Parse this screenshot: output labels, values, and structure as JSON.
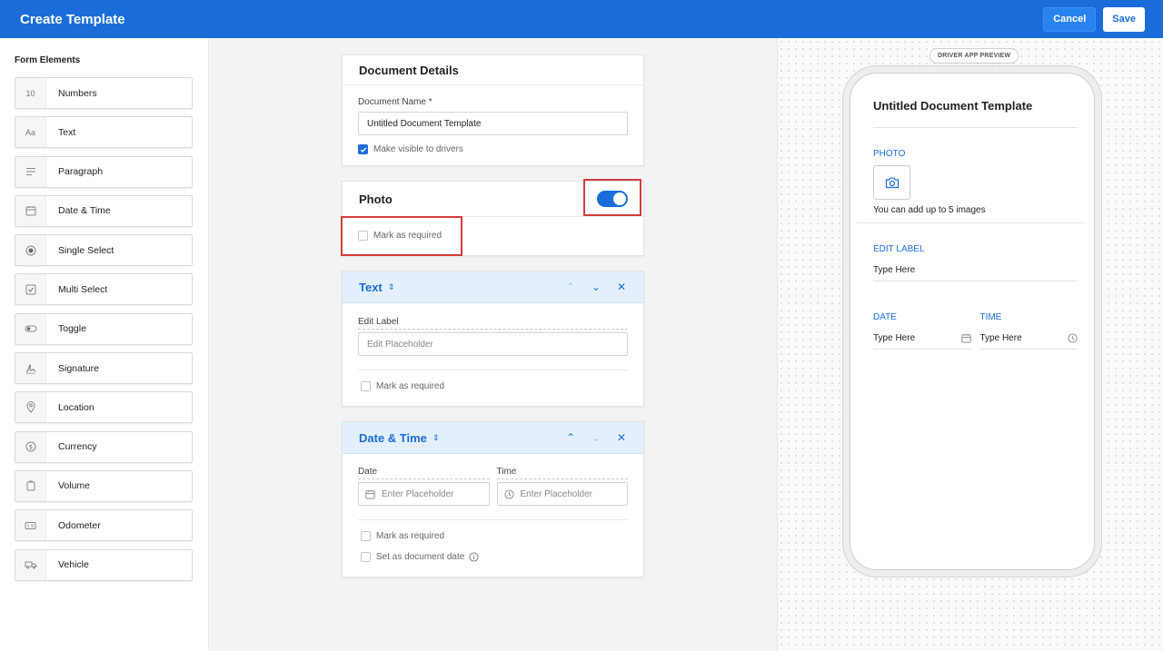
{
  "header": {
    "title": "Create Template",
    "cancel_label": "Cancel",
    "save_label": "Save"
  },
  "sidebar": {
    "heading": "Form Elements",
    "items": [
      {
        "label": "Numbers",
        "icon": "10"
      },
      {
        "label": "Text",
        "icon": "Aa"
      },
      {
        "label": "Paragraph",
        "icon": "paragraph-icon"
      },
      {
        "label": "Date & Time",
        "icon": "calendar-icon"
      },
      {
        "label": "Single Select",
        "icon": "radio-icon"
      },
      {
        "label": "Multi Select",
        "icon": "checkbox-icon"
      },
      {
        "label": "Toggle",
        "icon": "toggle-icon"
      },
      {
        "label": "Signature",
        "icon": "signature-icon"
      },
      {
        "label": "Location",
        "icon": "location-pin-icon"
      },
      {
        "label": "Currency",
        "icon": "dollar-icon"
      },
      {
        "label": "Volume",
        "icon": "volume-icon"
      },
      {
        "label": "Odometer",
        "icon": "odometer-icon"
      },
      {
        "label": "Vehicle",
        "icon": "truck-icon"
      }
    ]
  },
  "document_details": {
    "heading": "Document Details",
    "name_label": "Document Name *",
    "name_value": "Untitled Document Template",
    "visible_label": "Make visible to drivers",
    "visible_checked": true
  },
  "photo_card": {
    "heading": "Photo",
    "toggle_on": true,
    "required_label": "Mark as required"
  },
  "text_card": {
    "heading": "Text",
    "edit_label": "Edit Label",
    "placeholder": "Edit Placeholder",
    "required_label": "Mark as required"
  },
  "datetime_card": {
    "heading": "Date & Time",
    "date_label": "Date",
    "time_label": "Time",
    "date_placeholder": "Enter Placeholder",
    "time_placeholder": "Enter Placeholder",
    "required_label": "Mark as required",
    "doc_date_label": "Set as document date"
  },
  "preview": {
    "badge": "DRIVER APP PREVIEW",
    "title": "Untitled Document Template",
    "photo_section": "PHOTO",
    "photo_hint": "You can add up to 5 images",
    "edit_label_section": "EDIT LABEL",
    "edit_label_value": "Type Here",
    "date_section": "DATE",
    "date_value": "Type Here",
    "time_section": "TIME",
    "time_value": "Type Here"
  },
  "colors": {
    "accent": "#1a6dd9",
    "highlight": "#d23c3c",
    "section_bg": "#e3f0fb"
  }
}
